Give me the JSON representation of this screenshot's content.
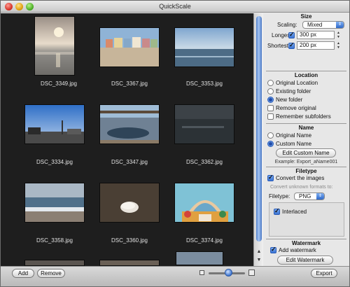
{
  "window": {
    "title": "QuickScale"
  },
  "grid": {
    "rows_visible": [
      [
        "DSC_3349.jpg",
        "DSC_3367.jpg",
        "DSC_3353.jpg"
      ],
      [
        "DSC_3334.jpg",
        "DSC_3347.jpg",
        "DSC_3362.jpg"
      ],
      [
        "DSC_3358.jpg",
        "DSC_3360.jpg",
        "DSC_3374.jpg"
      ]
    ],
    "items": [
      {
        "name": "DSC_3349.jpg",
        "thumb": "sunset-beach-portrait"
      },
      {
        "name": "DSC_3367.jpg",
        "thumb": "beach-houses"
      },
      {
        "name": "DSC_3353.jpg",
        "thumb": "ocean-horizon"
      },
      {
        "name": "DSC_3334.jpg",
        "thumb": "street-sky"
      },
      {
        "name": "DSC_3347.jpg",
        "thumb": "pier-tidepool"
      },
      {
        "name": "DSC_3362.jpg",
        "thumb": "dark-water"
      },
      {
        "name": "DSC_3358.jpg",
        "thumb": "waves-shore"
      },
      {
        "name": "DSC_3360.jpg",
        "thumb": "stone-on-sand"
      },
      {
        "name": "DSC_3374.jpg",
        "thumb": "carousel-mural"
      }
    ]
  },
  "size": {
    "heading": "Size",
    "scaling_label": "Scaling:",
    "scaling_value": "Mixed",
    "longest_label": "Longest:",
    "longest_value": "300 px",
    "longest_checked": true,
    "shortest_label": "Shortest:",
    "shortest_value": "200 px",
    "shortest_checked": true
  },
  "location": {
    "heading": "Location",
    "options": [
      "Original Location",
      "Existing folder",
      "New folder"
    ],
    "selected": "New folder",
    "remove_original": "Remove original",
    "remember_subfolders": "Remember subfolders"
  },
  "name": {
    "heading": "Name",
    "options": [
      "Original Name",
      "Custom Name"
    ],
    "selected": "Custom Name",
    "edit_button": "Edit Custom Name",
    "example": "Example: Export_aName001"
  },
  "filetype": {
    "heading": "Filetype",
    "convert_label": "Convert the images",
    "convert_checked": true,
    "unknown_label": "Convert unknown formats to:",
    "filetype_label": "Filetype:",
    "filetype_value": "PNG",
    "interlaced_label": "Interlaced",
    "interlaced_checked": true
  },
  "watermark": {
    "heading": "Watermark",
    "add_label": "Add watermark",
    "add_checked": true,
    "edit_button": "Edit Watermark"
  },
  "bottom": {
    "add_label": "Add",
    "remove_label": "Remove",
    "export_label": "Export",
    "zoom_level": 0.55
  },
  "colors": {
    "accent": "#3b74d4",
    "grid_bg": "#1e1e1e"
  }
}
